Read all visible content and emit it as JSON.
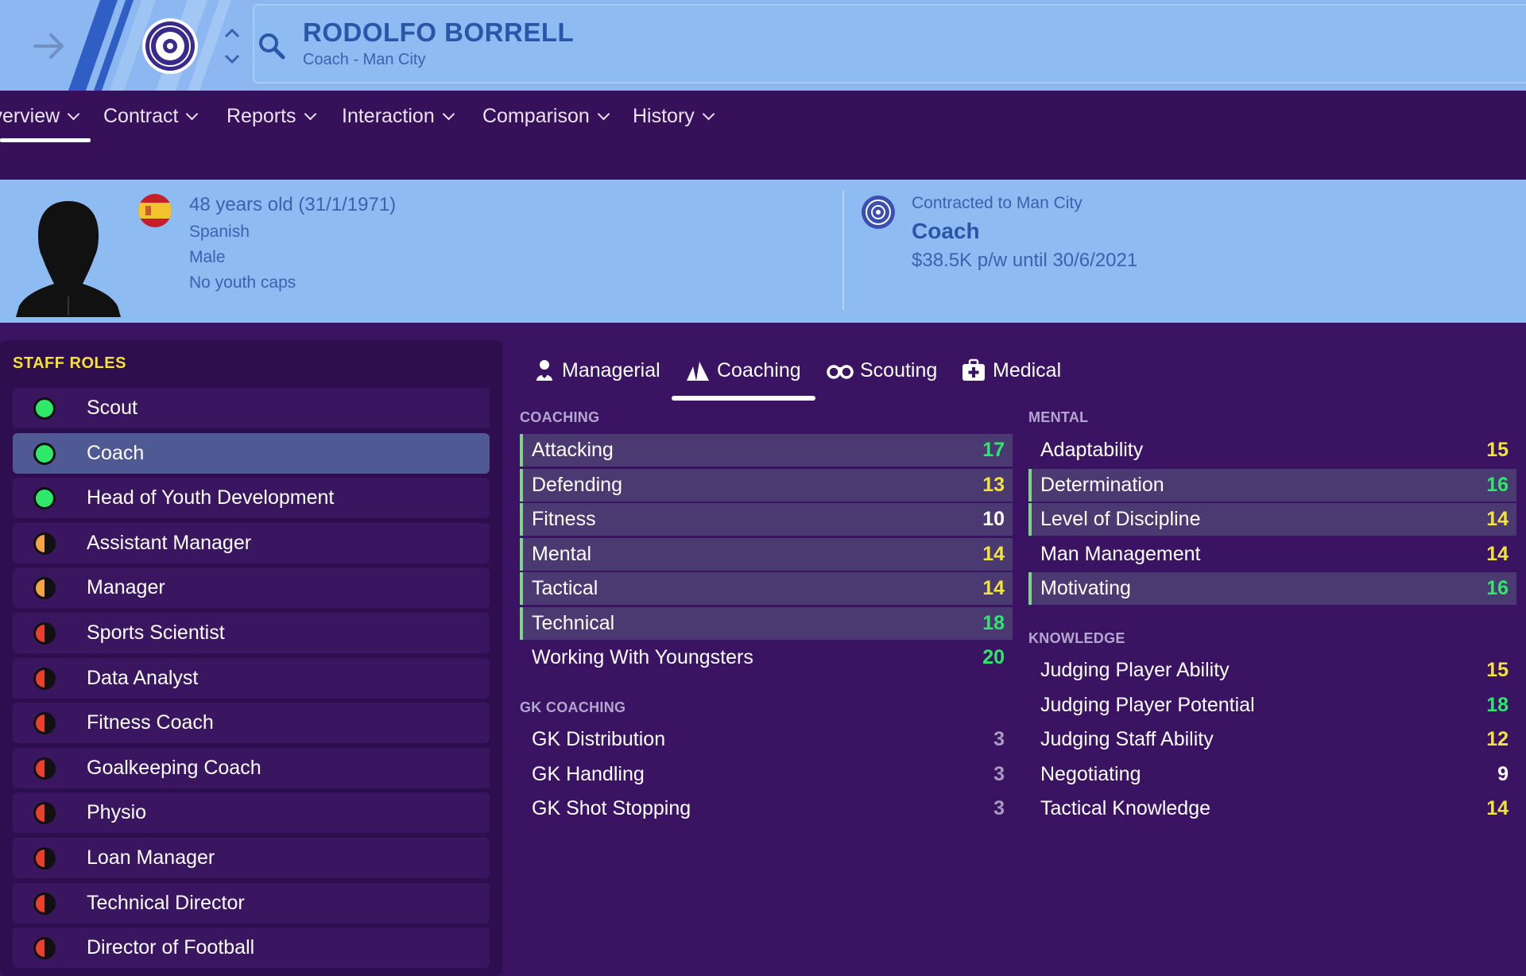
{
  "header": {
    "name": "RODOLFO BORRELL",
    "subtitle": "Coach - Man City"
  },
  "nav": {
    "items": [
      {
        "label": "Overview"
      },
      {
        "label": "Contract"
      },
      {
        "label": "Reports"
      },
      {
        "label": "Interaction"
      },
      {
        "label": "Comparison"
      },
      {
        "label": "History"
      }
    ]
  },
  "info": {
    "age": "48 years old (31/1/1971)",
    "nationality": "Spanish",
    "gender": "Male",
    "caps": "No youth caps",
    "contract_line": "Contracted to Man City",
    "role": "Coach",
    "wage": "$38.5K p/w until 30/6/2021"
  },
  "staff_roles": {
    "title": "STAFF ROLES",
    "items": [
      {
        "label": "Scout",
        "suitability": "green"
      },
      {
        "label": "Coach",
        "suitability": "green"
      },
      {
        "label": "Head of Youth Development",
        "suitability": "green"
      },
      {
        "label": "Assistant Manager",
        "suitability": "orange"
      },
      {
        "label": "Manager",
        "suitability": "orange"
      },
      {
        "label": "Sports Scientist",
        "suitability": "red"
      },
      {
        "label": "Data Analyst",
        "suitability": "red"
      },
      {
        "label": "Fitness Coach",
        "suitability": "red"
      },
      {
        "label": "Goalkeeping Coach",
        "suitability": "red"
      },
      {
        "label": "Physio",
        "suitability": "red"
      },
      {
        "label": "Loan Manager",
        "suitability": "red"
      },
      {
        "label": "Technical Director",
        "suitability": "red"
      },
      {
        "label": "Director of Football",
        "suitability": "red"
      }
    ]
  },
  "tabs": [
    {
      "label": "Managerial",
      "icon": "managerial-icon"
    },
    {
      "label": "Coaching",
      "icon": "whistle-icon"
    },
    {
      "label": "Scouting",
      "icon": "binoculars-icon"
    },
    {
      "label": "Medical",
      "icon": "medical-kit-icon"
    }
  ],
  "attributes": {
    "coaching": {
      "title": "COACHING",
      "items": [
        {
          "name": "Attacking",
          "value": "17"
        },
        {
          "name": "Defending",
          "value": "13"
        },
        {
          "name": "Fitness",
          "value": "10"
        },
        {
          "name": "Mental",
          "value": "14"
        },
        {
          "name": "Tactical",
          "value": "14"
        },
        {
          "name": "Technical",
          "value": "18"
        },
        {
          "name": "Working With Youngsters",
          "value": "20"
        }
      ]
    },
    "gk_coaching": {
      "title": "GK COACHING",
      "items": [
        {
          "name": "GK Distribution",
          "value": "3"
        },
        {
          "name": "GK Handling",
          "value": "3"
        },
        {
          "name": "GK Shot Stopping",
          "value": "3"
        }
      ]
    },
    "mental": {
      "title": "MENTAL",
      "items": [
        {
          "name": "Adaptability",
          "value": "15"
        },
        {
          "name": "Determination",
          "value": "16"
        },
        {
          "name": "Level of Discipline",
          "value": "14"
        },
        {
          "name": "Man Management",
          "value": "14"
        },
        {
          "name": "Motivating",
          "value": "16"
        }
      ]
    },
    "knowledge": {
      "title": "KNOWLEDGE",
      "items": [
        {
          "name": "Judging Player Ability",
          "value": "15"
        },
        {
          "name": "Judging Player Potential",
          "value": "18"
        },
        {
          "name": "Judging Staff Ability",
          "value": "12"
        },
        {
          "name": "Negotiating",
          "value": "9"
        },
        {
          "name": "Tactical Knowledge",
          "value": "14"
        }
      ]
    }
  },
  "colors": {
    "green": "#2ee86a",
    "yellow": "#f2e33a",
    "white": "#ffffff",
    "grey": "#a99bbf",
    "orange": "#f5a544",
    "red": "#e8402c",
    "accent_blue": "#8ebbf2",
    "panel_purple": "#2e0e4e"
  }
}
